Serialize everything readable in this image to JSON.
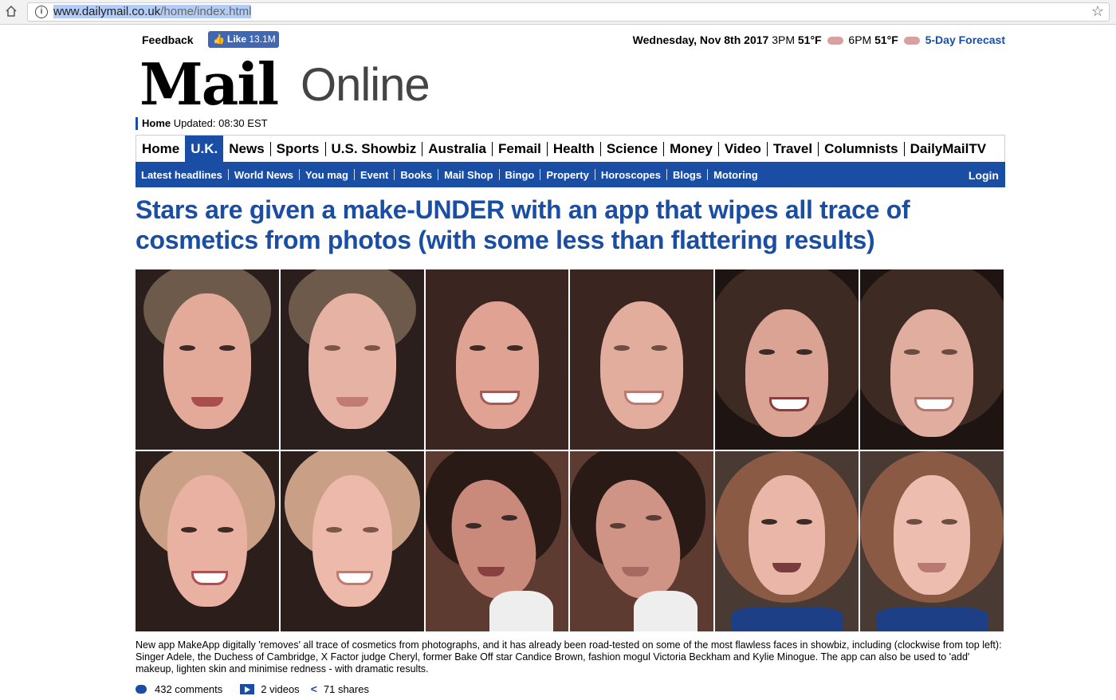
{
  "browser": {
    "url_host": "www.dailymail.co.uk",
    "url_path": "/home/index.html"
  },
  "topbar": {
    "feedback": "Feedback",
    "like_label": "Like",
    "like_count": "13.1M",
    "date": "Wednesday, Nov 8th 2017",
    "weather1_time": "3PM",
    "weather1_temp": "51°F",
    "weather2_time": "6PM",
    "weather2_temp": "51°F",
    "forecast_link": "5-Day Forecast"
  },
  "logo": {
    "mail": "Mail",
    "online": "Online"
  },
  "updated": {
    "home": "Home",
    "text": "Updated: 08:30 EST"
  },
  "nav": {
    "items": [
      "Home",
      "U.K.",
      "News",
      "Sports",
      "U.S. Showbiz",
      "Australia",
      "Femail",
      "Health",
      "Science",
      "Money",
      "Video",
      "Travel",
      "Columnists",
      "DailyMailTV"
    ],
    "active": "U.K."
  },
  "subnav": {
    "items": [
      "Latest headlines",
      "World News",
      "You mag",
      "Event",
      "Books",
      "Mail Shop",
      "Bingo",
      "Property",
      "Horoscopes",
      "Blogs",
      "Motoring"
    ],
    "login": "Login"
  },
  "article": {
    "headline": "Stars are given a make-UNDER with an app that wipes all trace of cosmetics from photos (with some less than flattering results)",
    "caption": "New app MakeApp digitally 'removes' all trace of cosmetics from photographs, and it has already been road-tested on some of the most flawless faces in showbiz, including (clockwise from top left): Singer Adele, the Duchess of Cambridge, X Factor judge Cheryl, former Bake Off star Candice Brown, fashion mogul Victoria Beckham and Kylie Minogue. The app can also be used to 'add' makeup, lighten skin and minimise redness - with dramatic results.",
    "comments": "432 comments",
    "videos": "2 videos",
    "shares": "71 shares"
  },
  "colors": {
    "brand_blue": "#1a4ea5",
    "facebook_blue": "#4267b2"
  }
}
